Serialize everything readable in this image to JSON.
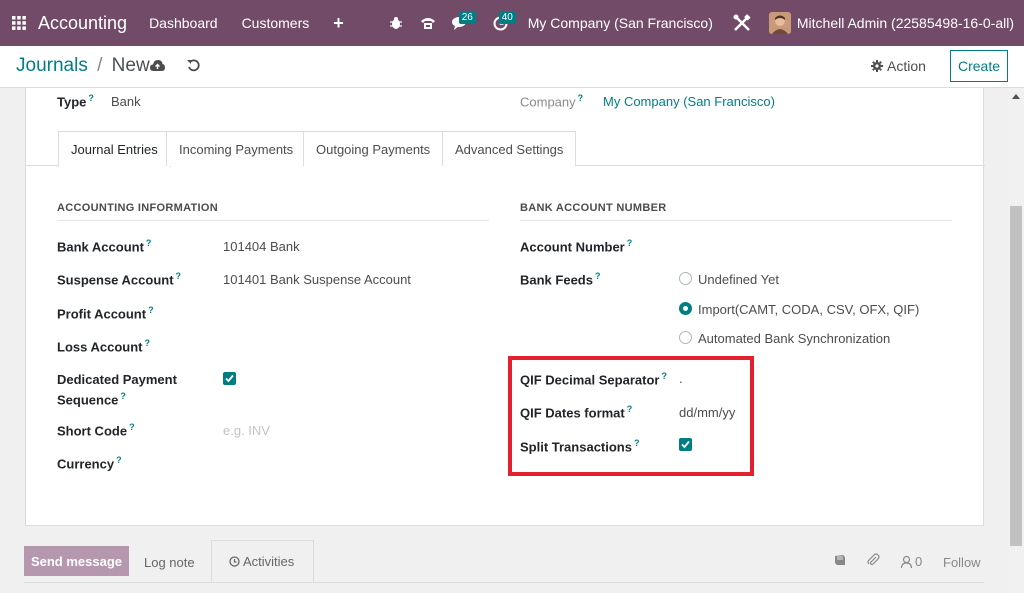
{
  "navbar": {
    "brand": "Accounting",
    "links": [
      "Dashboard",
      "Customers"
    ],
    "plus": "+",
    "chat_count": "26",
    "activity_count": "40",
    "company": "My Company (San Francisco)",
    "user": "Mitchell Admin (22585498-16-0-all)"
  },
  "breadcrumb": {
    "parent": "Journals",
    "separator": "/",
    "current": "New"
  },
  "control": {
    "action_label": "Action",
    "create_label": "Create"
  },
  "header_fields": {
    "type_label": "Type",
    "type_value": "Bank",
    "company_label": "Company",
    "company_value": "My Company (San Francisco)",
    "help": "?"
  },
  "tabs": [
    "Journal Entries",
    "Incoming Payments",
    "Outgoing Payments",
    "Advanced Settings"
  ],
  "accounting": {
    "title": "ACCOUNTING INFORMATION",
    "bank_account_label": "Bank Account",
    "bank_account_value": "101404 Bank",
    "suspense_label": "Suspense Account",
    "suspense_value": "101401 Bank Suspense Account",
    "profit_label": "Profit Account",
    "loss_label": "Loss Account",
    "dedicated_label_1": "Dedicated Payment",
    "dedicated_label_2": "Sequence",
    "dedicated_checked": true,
    "short_code_label": "Short Code",
    "short_code_placeholder": "e.g. INV",
    "currency_label": "Currency"
  },
  "bank": {
    "title": "BANK ACCOUNT NUMBER",
    "account_number_label": "Account Number",
    "feeds_label": "Bank Feeds",
    "feed_options": [
      "Undefined Yet",
      "Import(CAMT, CODA, CSV, OFX, QIF)",
      "Automated Bank Synchronization"
    ],
    "feed_selected": 1,
    "qif_sep_label": "QIF Decimal Separator",
    "qif_sep_value": ".",
    "qif_dates_label": "QIF Dates format",
    "qif_dates_value": "dd/mm/yy",
    "split_label": "Split Transactions",
    "split_checked": true
  },
  "chatter": {
    "send_message": "Send message",
    "log_note": "Log note",
    "activities": "Activities",
    "followers_count": "0",
    "follow": "Follow"
  },
  "colors": {
    "navbar": "#714b67",
    "accent": "#017e84",
    "highlight": "#e3202d"
  }
}
